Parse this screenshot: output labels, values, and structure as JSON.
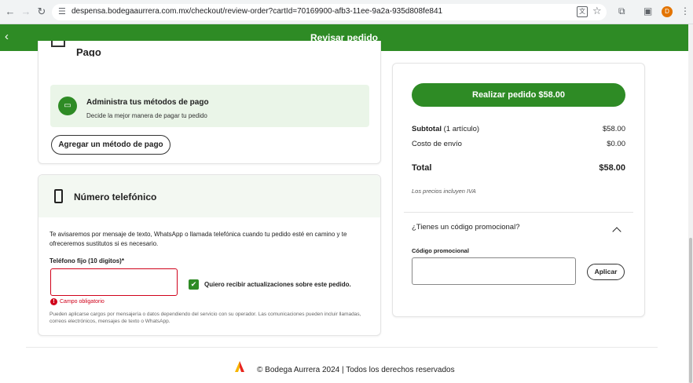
{
  "browser": {
    "url": "despensa.bodegaaurrera.com.mx/checkout/review-order?cartId=70169900-afb3-11ee-9a2a-935d808fe841",
    "profile_initial": "D"
  },
  "header": {
    "title": "Revisar pedido"
  },
  "payment": {
    "title": "Pago",
    "box_title": "Administra tus métodos de pago",
    "box_subtitle": "Decide la mejor manera de pagar tu pedido",
    "add_button": "Agregar un método de pago"
  },
  "phone": {
    "title": "Número telefónico",
    "description": "Te avisaremos por mensaje de texto, WhatsApp o llamada telefónica cuando tu pedido esté en camino y te ofreceremos sustitutos si es necesario.",
    "field_label": "Teléfono fijo (10 digitos)*",
    "field_value": "",
    "checkbox_label": "Quiero recibir actualizaciones sobre este pedido.",
    "checkbox_checked": true,
    "error": "Campo obligatorio",
    "disclaimer": "Pueden aplicarse cargos por mensajería o datos dependiendo del servicio con su operador. Las comunicaciones pueden incluir llamadas, correos electrónicos, mensajes de texto o WhatsApp."
  },
  "summary": {
    "place_order": "Realizar pedido $58.00",
    "subtotal_label": "Subtotal",
    "subtotal_count": "(1 artículo)",
    "subtotal_value": "$58.00",
    "shipping_label": "Costo de envío",
    "shipping_value": "$0.00",
    "total_label": "Total",
    "total_value": "$58.00",
    "tax_note": "Los precios incluyen IVA",
    "promo_question": "¿Tienes un código promocional?",
    "promo_label": "Código promocional",
    "promo_value": "",
    "apply_button": "Aplicar"
  },
  "footer": {
    "text": "© Bodega Aurrera 2024 | Todos los derechos reservados"
  },
  "colors": {
    "brand_green": "#2e8b25",
    "error_red": "#d0021b"
  }
}
